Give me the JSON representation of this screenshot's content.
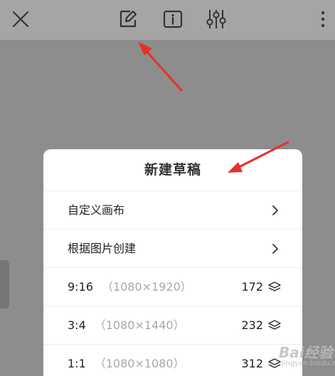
{
  "toolbar": {
    "close_icon": "close-icon",
    "draft_icon": "new-draft-icon",
    "info_icon": "info-icon",
    "adjust_icon": "sliders-icon",
    "more_icon": "more-vertical-icon"
  },
  "sheet": {
    "title": "新建草稿",
    "rows": [
      {
        "label": "自定义画布",
        "icon": "chevron-right-icon"
      },
      {
        "label": "根据图片创建",
        "icon": "chevron-right-icon"
      },
      {
        "label": "9:16",
        "dims": "（1080×1920）",
        "count": "172",
        "icon": "layers-icon"
      },
      {
        "label": "3:4",
        "dims": "（1080×1440）",
        "count": "232",
        "icon": "layers-icon"
      },
      {
        "label": "1:1",
        "dims": "（1080×1080）",
        "count": "312",
        "icon": "layers-icon"
      }
    ]
  },
  "watermark": {
    "text": "Bai经验",
    "sub": "jingyan.baidu.com"
  },
  "colors": {
    "annotation_arrow": "#e8302a",
    "overlay": "#8d8d8d",
    "toolbar": "#a5a5a5"
  }
}
